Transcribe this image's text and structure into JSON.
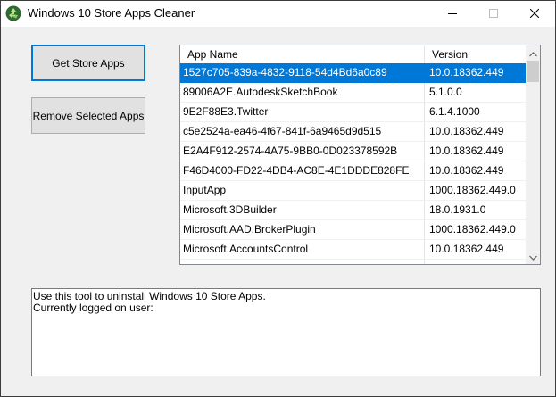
{
  "window": {
    "title": "Windows 10 Store Apps Cleaner"
  },
  "buttons": {
    "get_store_apps": "Get Store Apps",
    "remove_selected_apps": "Remove Selected Apps"
  },
  "list": {
    "columns": [
      "App Name",
      "Version"
    ],
    "rows": [
      {
        "name": "1527c705-839a-4832-9118-54d4Bd6a0c89",
        "version": "10.0.18362.449",
        "selected": true
      },
      {
        "name": "89006A2E.AutodeskSketchBook",
        "version": "5.1.0.0"
      },
      {
        "name": "9E2F88E3.Twitter",
        "version": "6.1.4.1000"
      },
      {
        "name": "c5e2524a-ea46-4f67-841f-6a9465d9d515",
        "version": "10.0.18362.449"
      },
      {
        "name": "E2A4F912-2574-4A75-9BB0-0D023378592B",
        "version": "10.0.18362.449"
      },
      {
        "name": "F46D4000-FD22-4DB4-AC8E-4E1DDDE828FE",
        "version": "10.0.18362.449"
      },
      {
        "name": "InputApp",
        "version": "1000.18362.449.0"
      },
      {
        "name": "Microsoft.3DBuilder",
        "version": "18.0.1931.0"
      },
      {
        "name": "Microsoft.AAD.BrokerPlugin",
        "version": "1000.18362.449.0"
      },
      {
        "name": "Microsoft.AccountsControl",
        "version": "10.0.18362.449"
      },
      {
        "name": "",
        "version": ""
      }
    ]
  },
  "log": {
    "lines": [
      "Use this tool to uninstall Windows 10 Store Apps.",
      "Currently logged on user:"
    ]
  },
  "colors": {
    "selection": "#0078d7",
    "button_face": "#e1e1e1",
    "window_bg": "#f0f0f0"
  },
  "icons": {
    "app": "recycle-icon",
    "minimize": "minimize-icon",
    "maximize": "maximize-icon",
    "close": "close-icon"
  }
}
